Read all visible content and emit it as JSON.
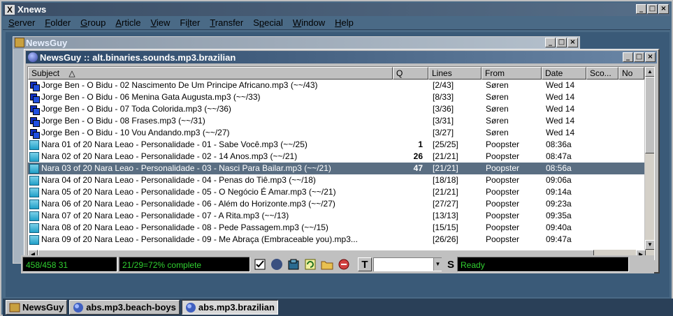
{
  "app": {
    "title": "Xnews",
    "logo": "X",
    "buttons": {
      "minimize": "_",
      "maximize": "□",
      "close": "×"
    }
  },
  "menu": [
    {
      "label": "Server",
      "u": "S",
      "rest": "erver"
    },
    {
      "label": "Folder",
      "u": "F",
      "rest": "older"
    },
    {
      "label": "Group",
      "u": "G",
      "rest": "roup"
    },
    {
      "label": "Article",
      "u": "A",
      "rest": "rticle"
    },
    {
      "label": "View",
      "u": "V",
      "rest": "iew"
    },
    {
      "label": "Filter",
      "pre": "Fi",
      "u": "l",
      "rest": "ter"
    },
    {
      "label": "Transfer",
      "u": "T",
      "rest": "ransfer"
    },
    {
      "label": "Special",
      "pre": "S",
      "u": "p",
      "rest": "ecial"
    },
    {
      "label": "Window",
      "u": "W",
      "rest": "indow"
    },
    {
      "label": "Help",
      "u": "H",
      "rest": "elp"
    }
  ],
  "back_window": {
    "title": "NewsGuy"
  },
  "group_window": {
    "title": "NewsGuy :: alt.binaries.sounds.mp3.brazilian",
    "columns": [
      {
        "key": "subject",
        "label": "Subject",
        "sort_glyph": "△"
      },
      {
        "key": "q",
        "label": "Q"
      },
      {
        "key": "lines",
        "label": "Lines"
      },
      {
        "key": "from",
        "label": "From"
      },
      {
        "key": "date",
        "label": "Date"
      },
      {
        "key": "score",
        "label": "Sco..."
      },
      {
        "key": "no",
        "label": "No"
      }
    ],
    "rows": [
      {
        "icon": "multi",
        "subject": "Jorge Ben - O Bidu - 02 Nascimento De Um Principe Africano.mp3 (~~/43)",
        "q": "",
        "lines": "[2/43]",
        "from": "Søren",
        "date": "Wed 14"
      },
      {
        "icon": "multi",
        "subject": "Jorge Ben - O Bidu - 06 Menina Gata Augusta.mp3 (~~/33)",
        "q": "",
        "lines": "[8/33]",
        "from": "Søren",
        "date": "Wed 14"
      },
      {
        "icon": "multi",
        "subject": "Jorge Ben - O Bidu - 07 Toda Colorida.mp3 (~~/36)",
        "q": "",
        "lines": "[3/36]",
        "from": "Søren",
        "date": "Wed 14"
      },
      {
        "icon": "multi",
        "subject": "Jorge Ben - O Bidu - 08 Frases.mp3 (~~/31)",
        "q": "",
        "lines": "[3/31]",
        "from": "Søren",
        "date": "Wed 14"
      },
      {
        "icon": "multi",
        "subject": "Jorge Ben - O Bidu - 10 Vou Andando.mp3 (~~/27)",
        "q": "",
        "lines": "[3/27]",
        "from": "Søren",
        "date": "Wed 14"
      },
      {
        "icon": "single",
        "subject": "Nara 01 of 20 Nara Leao - Personalidade - 01 - Sabe Você.mp3 (~~/25)",
        "q": "1",
        "lines": "[25/25]",
        "from": "Poopster",
        "date": "08:36a"
      },
      {
        "icon": "single",
        "subject": "Nara 02 of 20 Nara Leao - Personalidade - 02 - 14 Anos.mp3 (~~/21)",
        "q": "26",
        "lines": "[21/21]",
        "from": "Poopster",
        "date": "08:47a"
      },
      {
        "icon": "single",
        "subject": "Nara 03 of 20 Nara Leao - Personalidade - 03 - Nasci Para Bailar.mp3 (~~/21)",
        "q": "47",
        "lines": "[21/21]",
        "from": "Poopster",
        "date": "08:56a",
        "selected": true
      },
      {
        "icon": "single",
        "subject": "Nara 04 of 20 Nara Leao - Personalidade - 04 - Penas do Tiê.mp3 (~~/18)",
        "q": "",
        "lines": "[18/18]",
        "from": "Poopster",
        "date": "09:06a"
      },
      {
        "icon": "single",
        "subject": "Nara 05 of 20 Nara Leao - Personalidade - 05 - O Negócio É Amar.mp3 (~~/21)",
        "q": "",
        "lines": "[21/21]",
        "from": "Poopster",
        "date": "09:14a"
      },
      {
        "icon": "single",
        "subject": "Nara 06 of 20 Nara Leao - Personalidade - 06 - Além do Horizonte.mp3 (~~/27)",
        "q": "",
        "lines": "[27/27]",
        "from": "Poopster",
        "date": "09:23a"
      },
      {
        "icon": "single",
        "subject": "Nara 07 of 20 Nara Leao - Personalidade - 07 - A Rita.mp3 (~~/13)",
        "q": "",
        "lines": "[13/13]",
        "from": "Poopster",
        "date": "09:35a"
      },
      {
        "icon": "single",
        "subject": "Nara 08 of 20 Nara Leao - Personalidade - 08 - Pede Passagem.mp3 (~~/15)",
        "q": "",
        "lines": "[15/15]",
        "from": "Poopster",
        "date": "09:40a"
      },
      {
        "icon": "single",
        "subject": "Nara 09 of 20 Nara Leao - Personalidade - 09 - Me Abraça (Embraceable you).mp3...",
        "q": "",
        "lines": "[26/26]",
        "from": "Poopster",
        "date": "09:47a"
      }
    ]
  },
  "status": {
    "counts": "458/458 31",
    "progress": "21/29=72% complete",
    "toolbar_icons": [
      "checklist-icon",
      "globe-icon",
      "decode-icon",
      "refresh-icon",
      "folder-icon",
      "stop-icon"
    ],
    "t_label": "T",
    "s_label": "S",
    "search_value": "",
    "state": "Ready"
  },
  "taskbar": [
    {
      "label": "NewsGuy",
      "icon": "newsguy-icon",
      "active": false
    },
    {
      "label": "abs.mp3.beach-boys",
      "icon": "group-icon",
      "active": false
    },
    {
      "label": "abs.mp3.brazilian",
      "icon": "group-icon",
      "active": true
    }
  ],
  "colors": {
    "selection": "#5a6e82",
    "status_text": "#30d030",
    "desktop": "#3a5a78"
  }
}
